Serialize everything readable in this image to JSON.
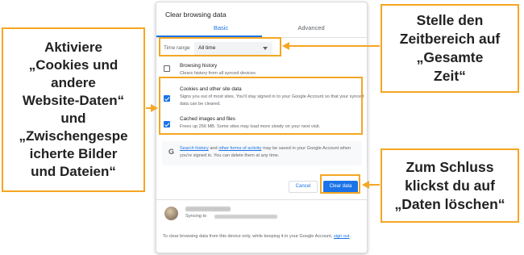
{
  "dialog": {
    "title": "Clear browsing data",
    "tabs": [
      "Basic",
      "Advanced"
    ],
    "time_range": {
      "label": "Time range",
      "value": "All time"
    },
    "options": [
      {
        "title": "Browsing history",
        "description": "Clears history from all synced devices",
        "checked": false
      },
      {
        "title": "Cookies and other site data",
        "description": "Signs you out of most sites. You'll stay signed in to your Google Account so that your synced data can be cleared.",
        "checked": true
      },
      {
        "title": "Cached images and files",
        "description": "Frees up 256 MB. Some sites may load more slowly on your next visit.",
        "checked": true
      }
    ],
    "info": {
      "link1": "Search history",
      "and": " and ",
      "link2": "other forms of activity",
      "rest": " may be saved in your Google Account when you're signed in. You can delete them at any time."
    },
    "buttons": {
      "cancel": "Cancel",
      "clear": "Clear data"
    },
    "account": {
      "syncing_label": "Syncing to"
    },
    "footer": {
      "text": "To clear browsing data from this device only, while keeping it in your Google Account, ",
      "link": "sign out",
      "end": "."
    }
  },
  "callouts": {
    "left": [
      "Aktiviere",
      "„Cookies und",
      "andere",
      "Website-Daten“",
      "und",
      "„Zwischengespe",
      "icherte Bilder",
      "und Dateien“"
    ],
    "right_top": [
      "Stelle den",
      "Zeitbereich auf",
      "„Gesamte",
      "Zeit“"
    ],
    "right_bottom": [
      "Zum Schluss",
      "klickst du auf",
      "„Daten löschen“"
    ]
  },
  "colors": {
    "accent": "#1a73e8",
    "highlight": "#f5a623"
  }
}
